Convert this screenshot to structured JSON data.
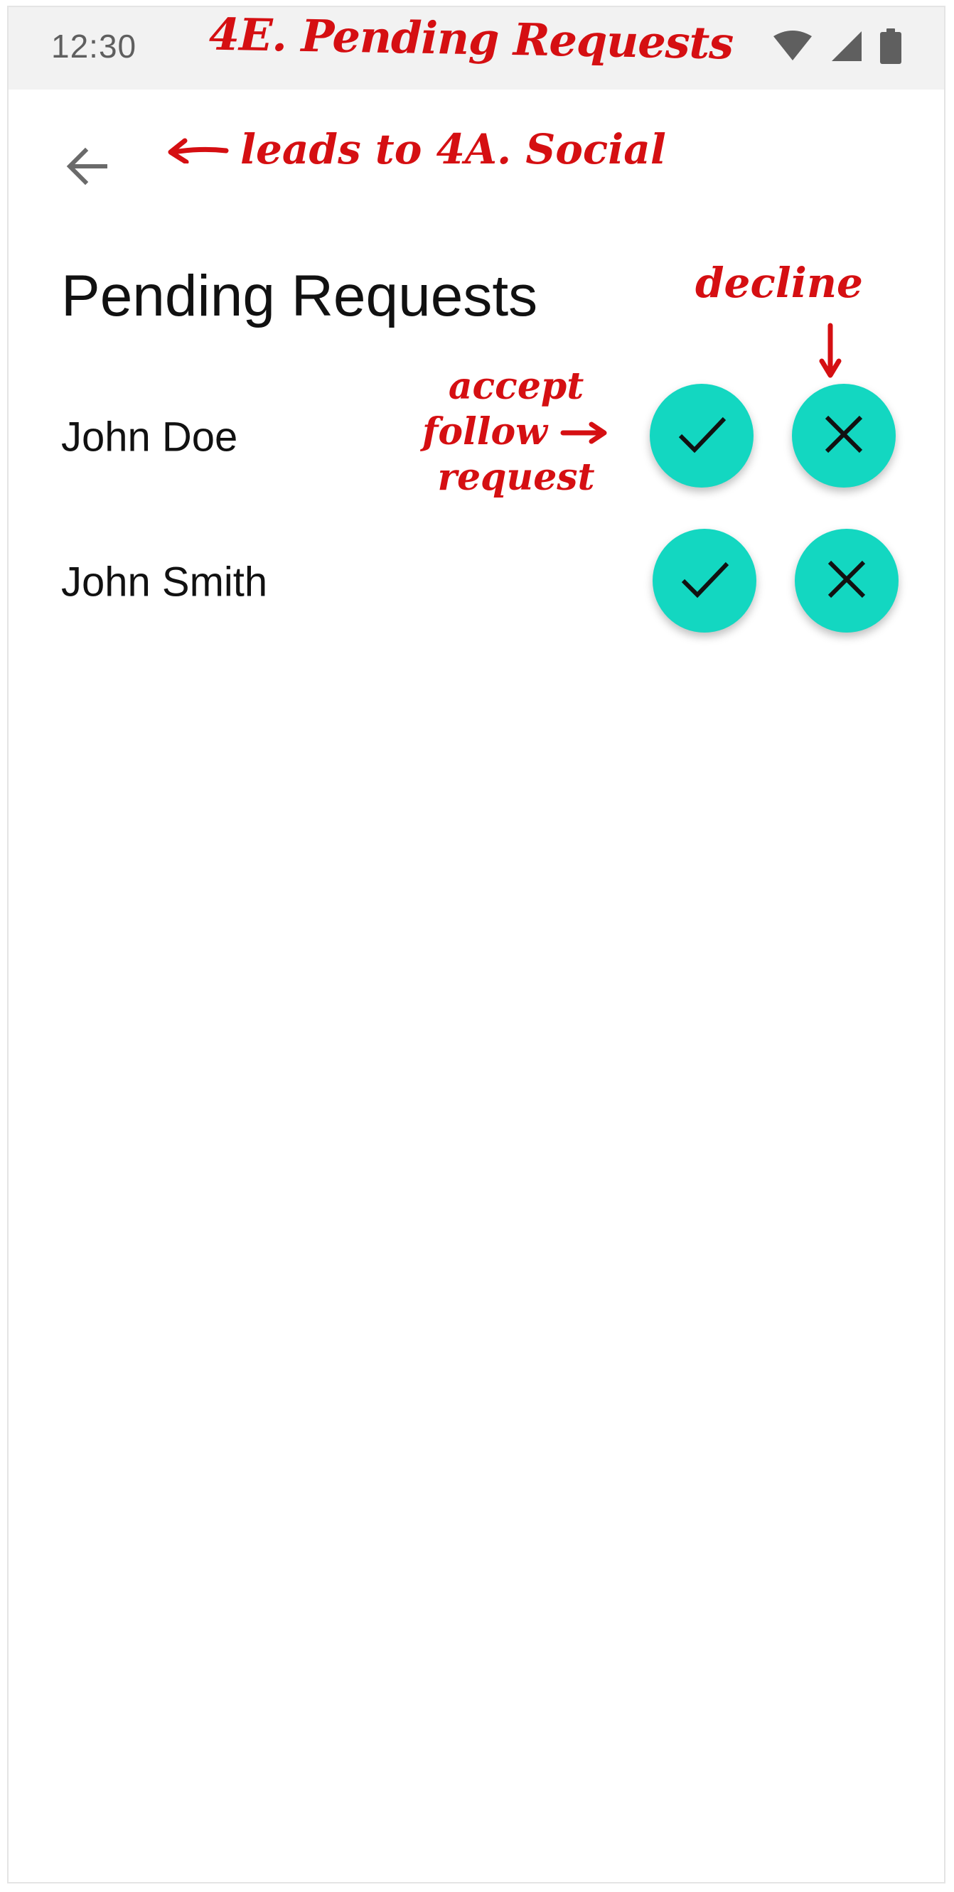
{
  "status_bar": {
    "time": "12:30",
    "icons": [
      "wifi-icon",
      "signal-icon",
      "battery-icon"
    ]
  },
  "annotations": {
    "screen_title": "4E. Pending Requests",
    "back_note": "leads to 4A. Social",
    "decline_note": "decline",
    "accept_note": [
      "accept",
      "follow",
      "request"
    ],
    "color": "#d50f12"
  },
  "header": {
    "back_icon": "arrow-back-icon",
    "title": "Pending Requests"
  },
  "requests": [
    {
      "name": "John Doe",
      "accept_icon": "check-icon",
      "decline_icon": "close-icon"
    },
    {
      "name": "John Smith",
      "accept_icon": "check-icon",
      "decline_icon": "close-icon"
    }
  ],
  "colors": {
    "accent": "#13d7c1",
    "status_bar_bg": "#f2f2f2"
  }
}
